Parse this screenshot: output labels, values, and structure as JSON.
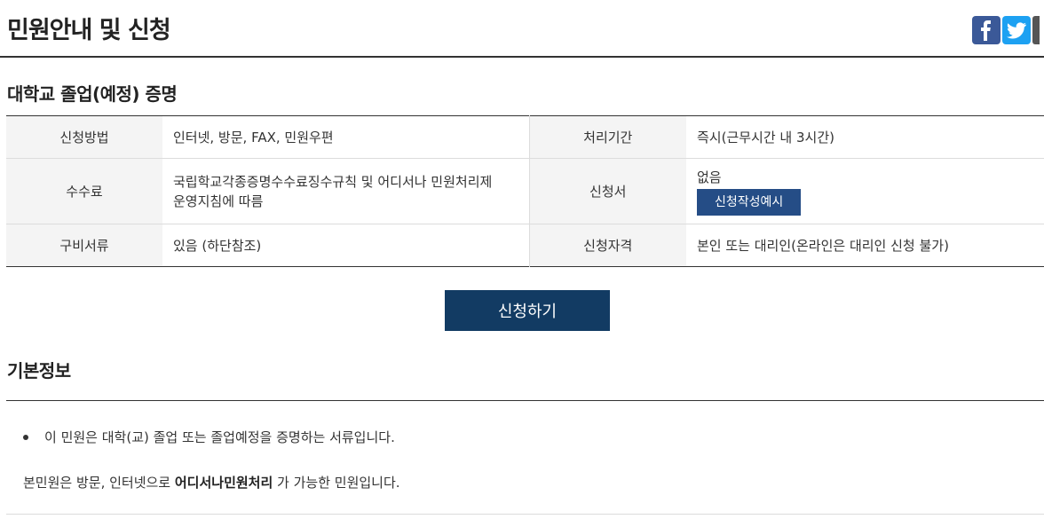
{
  "header": {
    "title": "민원안내 및 신청",
    "share": {
      "facebook_icon": "facebook-icon",
      "twitter_icon": "twitter-icon"
    }
  },
  "service": {
    "title": "대학교 졸업(예정) 증명",
    "rows": [
      {
        "label1": "신청방법",
        "value1": "인터넷, 방문, FAX, 민원우편",
        "label2": "처리기간",
        "value2": "즉시(근무시간 내 3시간)"
      },
      {
        "label1": "수수료",
        "value1a": "국립학교각종증명수수료징수규칙 및 어디서나 민원처리제",
        "value1b": "운영지침에 따름",
        "label2": "신청서",
        "value2": "없음",
        "button": "신청작성예시"
      },
      {
        "label1": "구비서류",
        "value1": "있음 (하단참조)",
        "label2": "신청자격",
        "value2": "본인 또는 대리인(온라인은 대리인 신청 불가)"
      }
    ],
    "apply_button": "신청하기"
  },
  "basic": {
    "title": "기본정보",
    "bullet": "이 민원은 대학(교) 졸업 또는 졸업예정을 증명하는 서류입니다.",
    "desc_prefix": "본민원은 방문, 인터넷으로 ",
    "desc_bold": "어디서나민원처리",
    "desc_suffix": " 가 가능한 민원입니다."
  },
  "colors": {
    "primary_button": "#123b63",
    "secondary_button": "#254d86",
    "facebook": "#3b5998",
    "twitter": "#1da1f2"
  }
}
